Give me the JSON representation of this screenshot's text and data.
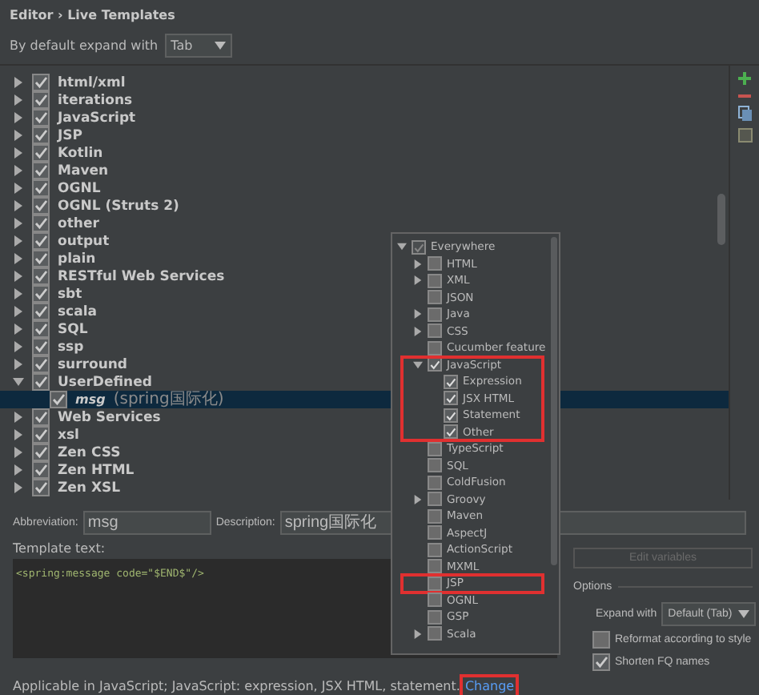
{
  "header": {
    "title": "Editor › Live Templates"
  },
  "expand_default": {
    "label": "By default expand with",
    "value": "Tab"
  },
  "groups": [
    {
      "name": "html/xml",
      "checked": true,
      "expanded": false
    },
    {
      "name": "iterations",
      "checked": true,
      "expanded": false
    },
    {
      "name": "JavaScript",
      "checked": true,
      "expanded": false
    },
    {
      "name": "JSP",
      "checked": true,
      "expanded": false
    },
    {
      "name": "Kotlin",
      "checked": true,
      "expanded": false
    },
    {
      "name": "Maven",
      "checked": true,
      "expanded": false
    },
    {
      "name": "OGNL",
      "checked": true,
      "expanded": false
    },
    {
      "name": "OGNL (Struts 2)",
      "checked": true,
      "expanded": false
    },
    {
      "name": "other",
      "checked": true,
      "expanded": false
    },
    {
      "name": "output",
      "checked": true,
      "expanded": false
    },
    {
      "name": "plain",
      "checked": true,
      "expanded": false
    },
    {
      "name": "RESTful Web Services",
      "checked": true,
      "expanded": false
    },
    {
      "name": "sbt",
      "checked": true,
      "expanded": false
    },
    {
      "name": "scala",
      "checked": true,
      "expanded": false
    },
    {
      "name": "SQL",
      "checked": true,
      "expanded": false
    },
    {
      "name": "ssp",
      "checked": true,
      "expanded": false
    },
    {
      "name": "surround",
      "checked": true,
      "expanded": false
    },
    {
      "name": "UserDefined",
      "checked": true,
      "expanded": true,
      "children": [
        {
          "name": "msg",
          "description": "(spring国际化)",
          "checked": true,
          "selected": true
        }
      ]
    },
    {
      "name": "Web Services",
      "checked": true,
      "expanded": false
    },
    {
      "name": "xsl",
      "checked": true,
      "expanded": false
    },
    {
      "name": "Zen CSS",
      "checked": true,
      "expanded": false
    },
    {
      "name": "Zen HTML",
      "checked": true,
      "expanded": false
    },
    {
      "name": "Zen XSL",
      "checked": true,
      "expanded": false
    }
  ],
  "abbreviation": {
    "label": "Abbreviation:",
    "value": "msg"
  },
  "description": {
    "label": "Description:",
    "value": "spring国际化"
  },
  "template_text": {
    "label": "Template text:",
    "value": "<spring:message code=\"$END$\"/>"
  },
  "applicable": {
    "text": "Applicable in JavaScript; JavaScript: expression, JSX HTML, statement.",
    "link": "Change",
    "highlighted": true
  },
  "edit_variables_button": {
    "label": "Edit variables",
    "disabled": true
  },
  "options": {
    "title": "Options",
    "expand_with": {
      "label": "Expand with",
      "value": "Default (Tab)"
    },
    "checkboxes": [
      {
        "label": "Reformat according to style",
        "checked": false
      },
      {
        "label": "Shorten FQ names",
        "checked": true
      }
    ]
  },
  "context_popup": {
    "items": [
      {
        "label": "Everywhere",
        "checked": true,
        "partial": true,
        "expandable": true,
        "expanded": true,
        "highlighted": false,
        "children": [
          {
            "label": "HTML",
            "checked": false,
            "expandable": true,
            "highlighted": false
          },
          {
            "label": "XML",
            "checked": false,
            "expandable": true,
            "highlighted": false
          },
          {
            "label": "JSON",
            "checked": false,
            "expandable": false,
            "highlighted": false
          },
          {
            "label": "Java",
            "checked": false,
            "expandable": true,
            "highlighted": false
          },
          {
            "label": "CSS",
            "checked": false,
            "expandable": true,
            "highlighted": false
          },
          {
            "label": "Cucumber feature",
            "checked": false,
            "expandable": false,
            "highlighted": false
          },
          {
            "label": "JavaScript",
            "checked": true,
            "expandable": true,
            "expanded": true,
            "highlighted": true,
            "children": [
              {
                "label": "Expression",
                "checked": true,
                "expandable": false,
                "highlighted": false
              },
              {
                "label": "JSX HTML",
                "checked": true,
                "expandable": false,
                "highlighted": false
              },
              {
                "label": "Statement",
                "checked": true,
                "expandable": false,
                "highlighted": false
              },
              {
                "label": "Other",
                "checked": true,
                "expandable": false,
                "highlighted": false
              }
            ]
          },
          {
            "label": "TypeScript",
            "checked": false,
            "expandable": false,
            "highlighted": false
          },
          {
            "label": "SQL",
            "checked": false,
            "expandable": false,
            "highlighted": false
          },
          {
            "label": "ColdFusion",
            "checked": false,
            "expandable": false,
            "highlighted": false
          },
          {
            "label": "Groovy",
            "checked": false,
            "expandable": true,
            "highlighted": false
          },
          {
            "label": "Maven",
            "checked": false,
            "expandable": false,
            "highlighted": false
          },
          {
            "label": "AspectJ",
            "checked": false,
            "expandable": false,
            "highlighted": false
          },
          {
            "label": "ActionScript",
            "checked": false,
            "expandable": false,
            "highlighted": false
          },
          {
            "label": "MXML",
            "checked": false,
            "expandable": false,
            "highlighted": false
          },
          {
            "label": "JSP",
            "checked": false,
            "expandable": false,
            "highlighted": true
          },
          {
            "label": "OGNL",
            "checked": false,
            "expandable": false,
            "highlighted": false
          },
          {
            "label": "GSP",
            "checked": false,
            "expandable": false,
            "highlighted": false
          },
          {
            "label": "Scala",
            "checked": false,
            "expandable": true,
            "highlighted": false
          }
        ]
      }
    ]
  }
}
